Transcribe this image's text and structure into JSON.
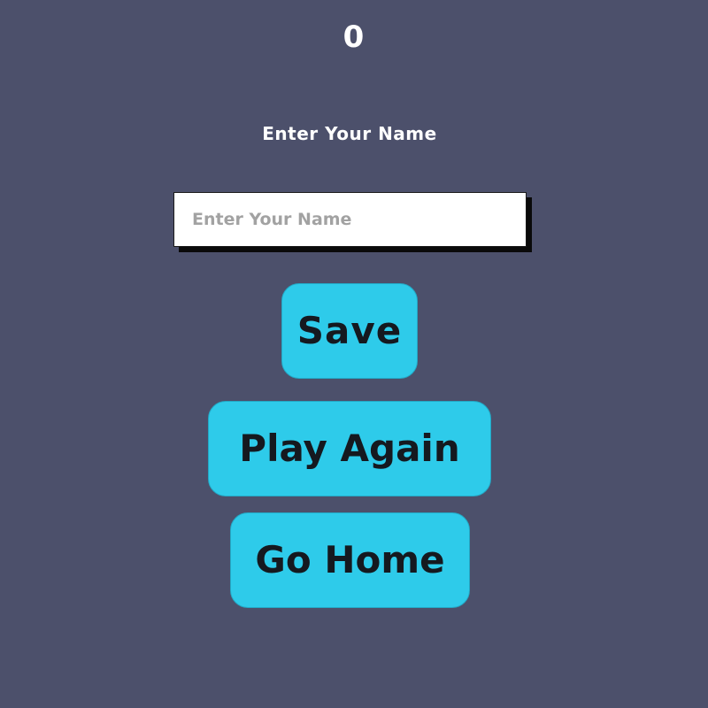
{
  "score": "0",
  "name_prompt": "Enter Your Name",
  "name_input": {
    "value": "",
    "placeholder": "Enter Your Name"
  },
  "buttons": {
    "save_label": "Save",
    "play_again_label": "Play Again",
    "go_home_label": "Go Home"
  },
  "colors": {
    "background": "#4c506b",
    "button": "#2ecbea",
    "button_text": "#15191f",
    "text": "#ffffff"
  }
}
